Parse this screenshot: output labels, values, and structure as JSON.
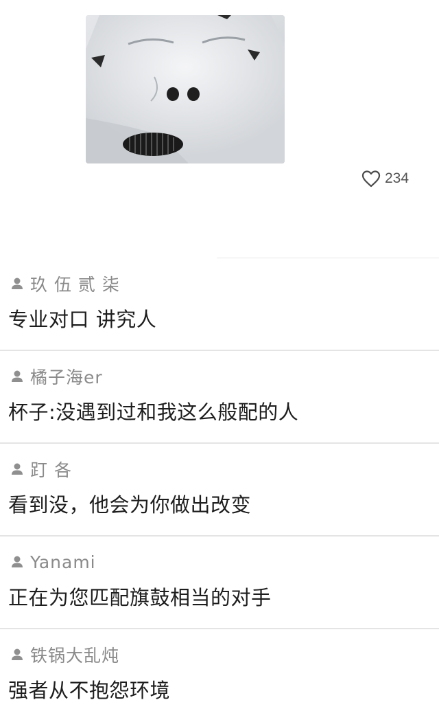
{
  "post": {
    "image_name": "snow-face-photo",
    "likes": "234"
  },
  "comments": [
    {
      "author": "玖 伍 贰 柒",
      "text": "专业对口 讲究人"
    },
    {
      "author": "橘子海er",
      "text": "杯子:没遇到过和我这么般配的人"
    },
    {
      "author": "䟓 各",
      "text": "看到没，他会为你做出改变"
    },
    {
      "author": "Yanami",
      "text": "正在为您匹配旗鼓相当的对手"
    },
    {
      "author": "铁锅大乱炖",
      "text": "强者从不抱怨环境"
    }
  ],
  "colors": {
    "divider": "#e4e4e4",
    "author_text": "#8a8a8a",
    "comment_text": "#1d1d1d",
    "icon_gray": "#8f8f8f"
  },
  "icons": {
    "like": "heart-outline-icon",
    "user": "user-silhouette-icon"
  }
}
